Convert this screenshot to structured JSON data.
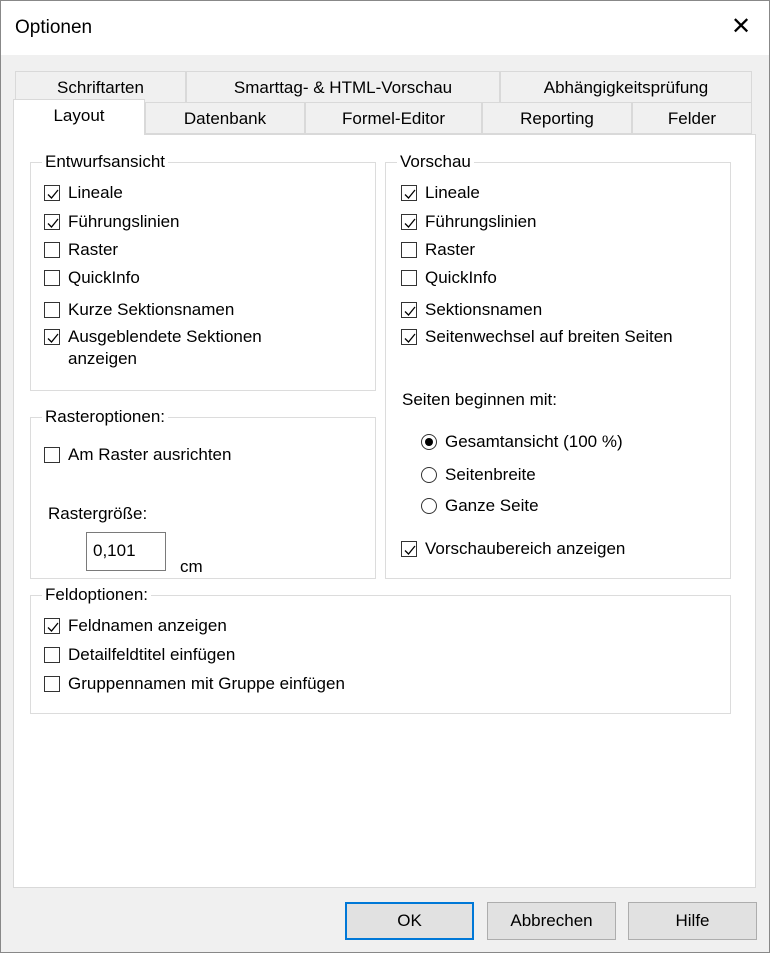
{
  "window": {
    "title": "Optionen"
  },
  "tabs_row1": [
    {
      "label": "Schriftarten"
    },
    {
      "label": "Smarttag- & HTML-Vorschau"
    },
    {
      "label": "Abhängigkeitsprüfung"
    }
  ],
  "tabs_row2": [
    {
      "label": "Layout",
      "selected": true
    },
    {
      "label": "Datenbank"
    },
    {
      "label": "Formel-Editor"
    },
    {
      "label": "Reporting"
    },
    {
      "label": "Felder"
    }
  ],
  "entwurf": {
    "title": "Entwurfsansicht",
    "items": [
      {
        "label": "Lineale",
        "checked": true
      },
      {
        "label": "Führungslinien",
        "checked": true
      },
      {
        "label": "Raster",
        "checked": false
      },
      {
        "label": "QuickInfo",
        "checked": false
      },
      {
        "label": "Kurze Sektionsnamen",
        "checked": false
      },
      {
        "label": "Ausgeblendete Sektionen",
        "label2": "anzeigen",
        "checked": true
      }
    ]
  },
  "raster": {
    "title": "Rasteroptionen:",
    "align": {
      "label": "Am Raster ausrichten",
      "checked": false
    },
    "size_label": "Rastergröße:",
    "size_value": "0,101",
    "unit": "cm"
  },
  "vorschau": {
    "title": "Vorschau",
    "items": [
      {
        "label": "Lineale",
        "checked": true
      },
      {
        "label": "Führungslinien",
        "checked": true
      },
      {
        "label": "Raster",
        "checked": false
      },
      {
        "label": "QuickInfo",
        "checked": false
      },
      {
        "label": "Sektionsnamen",
        "checked": true
      },
      {
        "label": "Seitenwechsel auf breiten Seiten",
        "checked": true
      }
    ],
    "start_label": "Seiten beginnen mit:",
    "radios": [
      {
        "label": "Gesamtansicht (100 %)",
        "selected": true
      },
      {
        "label": "Seitenbreite",
        "selected": false
      },
      {
        "label": "Ganze Seite",
        "selected": false
      }
    ],
    "preview_area": {
      "label": "Vorschaubereich anzeigen",
      "checked": true
    }
  },
  "feld": {
    "title": "Feldoptionen:",
    "items": [
      {
        "label": "Feldnamen anzeigen",
        "checked": true
      },
      {
        "label": "Detailfeldtitel einfügen",
        "checked": false
      },
      {
        "label": "Gruppennamen mit Gruppe einfügen",
        "checked": false
      }
    ]
  },
  "buttons": {
    "ok": "OK",
    "cancel": "Abbrechen",
    "help": "Hilfe"
  }
}
